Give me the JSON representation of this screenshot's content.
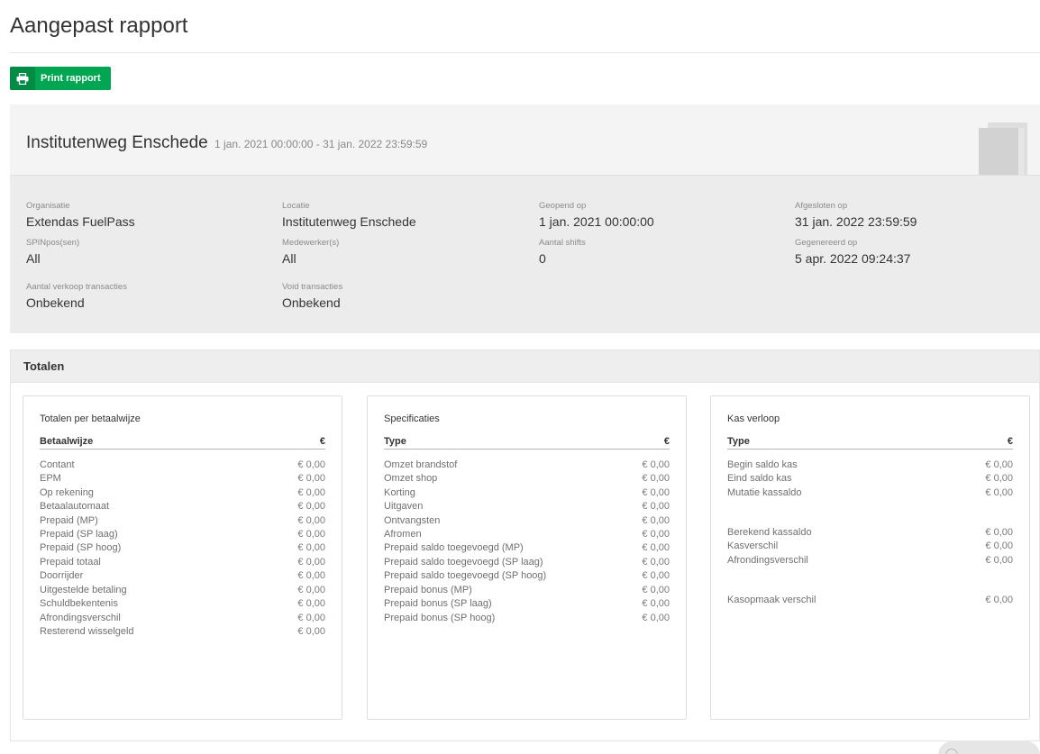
{
  "page": {
    "title": "Aangepast rapport",
    "print_label": "Print rapport"
  },
  "location": {
    "name": "Institutenweg Enschede",
    "period": "1 jan. 2021 00:00:00 - 31 jan. 2022 23:59:59"
  },
  "info": {
    "organisatie": {
      "label": "Organisatie",
      "value": "Extendas FuelPass"
    },
    "locatie": {
      "label": "Locatie",
      "value": "Institutenweg Enschede"
    },
    "geopend": {
      "label": "Geopend op",
      "value": "1 jan. 2021 00:00:00"
    },
    "afgesloten": {
      "label": "Afgesloten op",
      "value": "31 jan. 2022 23:59:59"
    },
    "spinpos": {
      "label": "SPINpos(sen)",
      "value": "All"
    },
    "medewerkers": {
      "label": "Medewerker(s)",
      "value": "All"
    },
    "shifts": {
      "label": "Aantal shifts",
      "value": "0"
    },
    "gegenereerd": {
      "label": "Gegenereerd op",
      "value": "5 apr. 2022 09:24:37"
    },
    "verkoop": {
      "label": "Aantal verkoop transacties",
      "value": "Onbekend"
    },
    "void": {
      "label": "Void transacties",
      "value": "Onbekend"
    }
  },
  "totals": {
    "title": "Totalen",
    "betaalwijze": {
      "title": "Totalen per betaalwijze",
      "col_name": "Betaalwijze",
      "col_value": "€",
      "rows": [
        {
          "name": "Contant",
          "value": "€ 0,00"
        },
        {
          "name": "EPM",
          "value": "€ 0,00"
        },
        {
          "name": "Op rekening",
          "value": "€ 0,00"
        },
        {
          "name": "Betaalautomaat",
          "value": "€ 0,00"
        },
        {
          "name": "Prepaid (MP)",
          "value": "€ 0,00"
        },
        {
          "name": "Prepaid (SP laag)",
          "value": "€ 0,00"
        },
        {
          "name": "Prepaid (SP hoog)",
          "value": "€ 0,00"
        },
        {
          "name": "Prepaid totaal",
          "value": "€ 0,00"
        },
        {
          "name": "Doorrijder",
          "value": "€ 0,00"
        },
        {
          "name": "Uitgestelde betaling",
          "value": "€ 0,00"
        },
        {
          "name": "Schuldbekentenis",
          "value": "€ 0,00"
        },
        {
          "name": "Afrondingsverschil",
          "value": "€ 0,00"
        },
        {
          "name": "Resterend wisselgeld",
          "value": "€ 0,00"
        }
      ]
    },
    "specificaties": {
      "title": "Specificaties",
      "col_name": "Type",
      "col_value": "€",
      "rows": [
        {
          "name": "Omzet brandstof",
          "value": "€ 0,00"
        },
        {
          "name": "Omzet shop",
          "value": "€ 0,00"
        },
        {
          "name": "Korting",
          "value": "€ 0,00"
        },
        {
          "name": "Uitgaven",
          "value": "€ 0,00"
        },
        {
          "name": "Ontvangsten",
          "value": "€ 0,00"
        },
        {
          "name": "Afromen",
          "value": "€ 0,00"
        },
        {
          "name": "Prepaid saldo toegevoegd (MP)",
          "value": "€ 0,00"
        },
        {
          "name": "Prepaid saldo toegevoegd (SP laag)",
          "value": "€ 0,00"
        },
        {
          "name": "Prepaid saldo toegevoegd (SP hoog)",
          "value": "€ 0,00"
        },
        {
          "name": "Prepaid bonus (MP)",
          "value": "€ 0,00"
        },
        {
          "name": "Prepaid bonus (SP laag)",
          "value": "€ 0,00"
        },
        {
          "name": "Prepaid bonus (SP hoog)",
          "value": "€ 0,00"
        }
      ]
    },
    "kas": {
      "title": "Kas verloop",
      "col_name": "Type",
      "col_value": "€",
      "rows": [
        {
          "name": "Begin saldo kas",
          "value": "€ 0,00"
        },
        {
          "name": "Eind saldo kas",
          "value": "€ 0,00"
        },
        {
          "name": "Mutatie kassaldo",
          "value": "€ 0,00"
        },
        {
          "name": "Berekend kassaldo",
          "value": "€ 0,00"
        },
        {
          "name": "Kasverschil",
          "value": "€ 0,00"
        },
        {
          "name": "Afrondingsverschil",
          "value": "€ 0,00"
        },
        {
          "name": "Kasopmaak verschil",
          "value": "€ 0,00"
        }
      ]
    }
  },
  "icons": {
    "print": "printer-icon",
    "book": "book-icon",
    "help": "help-icon"
  },
  "colors": {
    "accent": "#00a651",
    "accent_dark": "#008c44"
  }
}
